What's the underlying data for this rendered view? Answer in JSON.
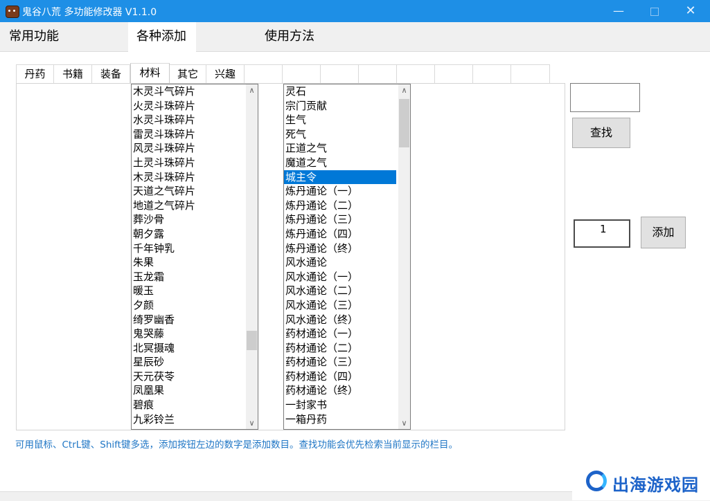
{
  "window": {
    "title": "鬼谷八荒 多功能修改器 V1.1.0",
    "minimize_glyph": "—",
    "close_glyph": "✕",
    "titlebar_color": "#1e8fe6"
  },
  "main_tabs": [
    {
      "label": "常用功能",
      "active": false
    },
    {
      "label": "各种添加",
      "active": true
    },
    {
      "label": "使用方法",
      "active": false
    }
  ],
  "sub_tabs": [
    {
      "label": "丹药",
      "active": false
    },
    {
      "label": "书籍",
      "active": false
    },
    {
      "label": "装备",
      "active": false
    },
    {
      "label": "材料",
      "active": true
    },
    {
      "label": "其它",
      "active": false
    },
    {
      "label": "兴趣",
      "active": false
    }
  ],
  "list_left": {
    "items": [
      "木灵斗气碎片",
      "火灵斗珠碎片",
      "水灵斗珠碎片",
      "雷灵斗珠碎片",
      "风灵斗珠碎片",
      "土灵斗珠碎片",
      "木灵斗珠碎片",
      "天道之气碎片",
      "地道之气碎片",
      "葬沙骨",
      "朝夕露",
      "千年钟乳",
      "朱果",
      "玉龙霜",
      "暖玉",
      "夕颜",
      "绮罗幽香",
      "鬼哭藤",
      "北冥摄魂",
      "星辰砂",
      "天元茯苓",
      "凤凰果",
      "碧痕",
      "九彩铃兰"
    ],
    "scroll_position": 0.85
  },
  "list_right": {
    "items": [
      "灵石",
      "宗门贡献",
      "生气",
      "死气",
      "正道之气",
      "魔道之气",
      "城主令",
      "炼丹通论（一）",
      "炼丹通论（二）",
      "炼丹通论（三）",
      "炼丹通论（四）",
      "炼丹通论（终）",
      "风水通论",
      "风水通论（一）",
      "风水通论（二）",
      "风水通论（三）",
      "风水通论（终）",
      "药材通论（一）",
      "药材通论（二）",
      "药材通论（三）",
      "药材通论（四）",
      "药材通论（终）",
      "一封家书",
      "一箱丹药"
    ],
    "selected": "城主令",
    "scroll_position": 0.0
  },
  "search": {
    "value": "",
    "button_label": "查找"
  },
  "add": {
    "quantity": "1",
    "button_label": "添加"
  },
  "scroll_up_glyph": "∧",
  "scroll_down_glyph": "∨",
  "hint_text": "可用鼠标、CtrL键、Shift键多选，添加按钮左边的数字是添加数目。查找功能会优先检索当前显示的栏目。",
  "watermark": {
    "text": "出海游戏园",
    "color": "#1d63c9"
  }
}
